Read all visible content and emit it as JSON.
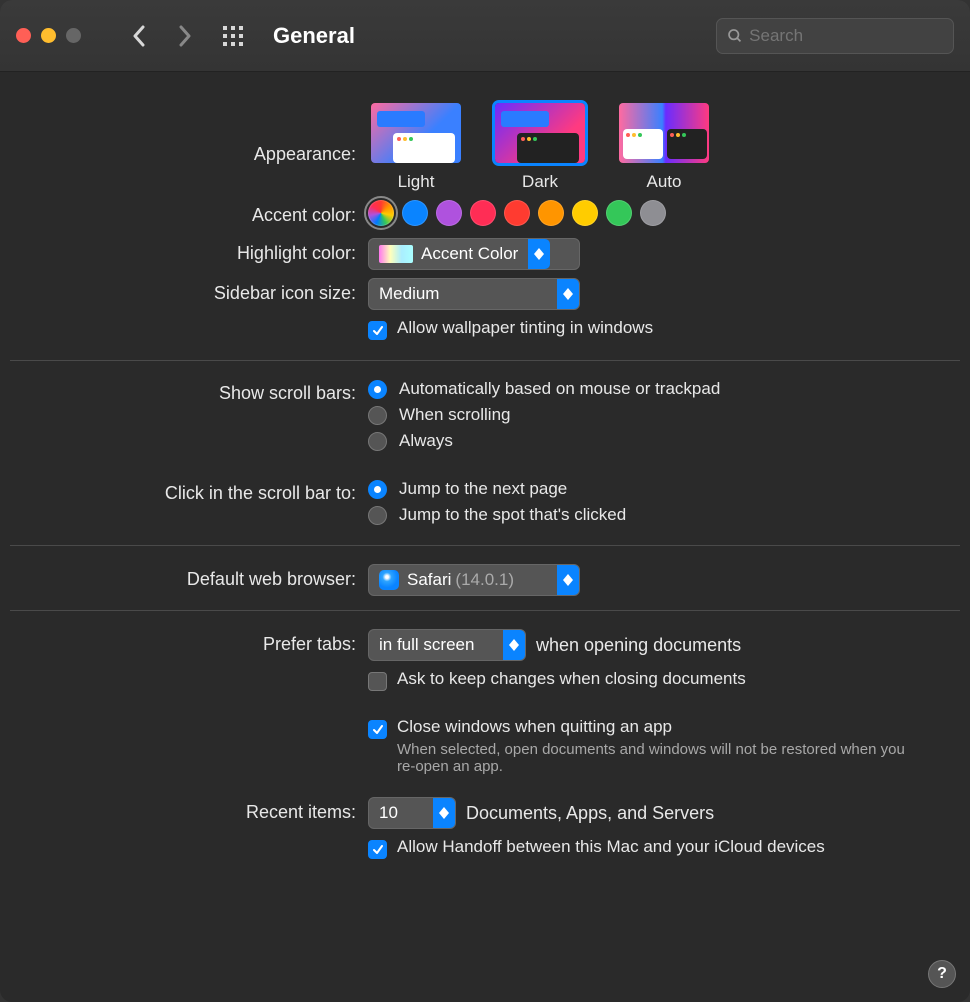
{
  "window": {
    "title": "General"
  },
  "search": {
    "placeholder": "Search"
  },
  "labels": {
    "appearance": "Appearance:",
    "accent": "Accent color:",
    "highlight": "Highlight color:",
    "sidebar_size": "Sidebar icon size:",
    "scrollbars": "Show scroll bars:",
    "click_scrollbar": "Click in the scroll bar to:",
    "default_browser": "Default web browser:",
    "prefer_tabs": "Prefer tabs:",
    "recent_items": "Recent items:"
  },
  "appearance": {
    "options": [
      {
        "label": "Light"
      },
      {
        "label": "Dark"
      },
      {
        "label": "Auto"
      }
    ],
    "selected": 1
  },
  "accent_colors": [
    {
      "name": "multicolor",
      "hex": "",
      "multicolor": true,
      "selected": true
    },
    {
      "name": "blue",
      "hex": "#0a84ff"
    },
    {
      "name": "purple",
      "hex": "#af52de"
    },
    {
      "name": "pink",
      "hex": "#ff2d55"
    },
    {
      "name": "red",
      "hex": "#ff3b30"
    },
    {
      "name": "orange",
      "hex": "#ff9500"
    },
    {
      "name": "yellow",
      "hex": "#ffcc00"
    },
    {
      "name": "green",
      "hex": "#34c759"
    },
    {
      "name": "graphite",
      "hex": "#8e8e93"
    }
  ],
  "highlight": {
    "value": "Accent Color"
  },
  "sidebar_size": {
    "value": "Medium"
  },
  "wallpaper_tinting": {
    "checked": true,
    "label": "Allow wallpaper tinting in windows"
  },
  "scrollbars": {
    "options": [
      "Automatically based on mouse or trackpad",
      "When scrolling",
      "Always"
    ],
    "selected": 0
  },
  "click_scrollbar": {
    "options": [
      "Jump to the next page",
      "Jump to the spot that's clicked"
    ],
    "selected": 0
  },
  "default_browser": {
    "name": "Safari",
    "version": "(14.0.1)"
  },
  "prefer_tabs": {
    "value": "in full screen",
    "suffix": "when opening documents"
  },
  "ask_keep_changes": {
    "checked": false,
    "label": "Ask to keep changes when closing documents"
  },
  "close_windows": {
    "checked": true,
    "label": "Close windows when quitting an app",
    "help": "When selected, open documents and windows will not be restored when you re-open an app."
  },
  "recent_items": {
    "value": "10",
    "suffix": "Documents, Apps, and Servers"
  },
  "handoff": {
    "checked": true,
    "label": "Allow Handoff between this Mac and your iCloud devices"
  }
}
